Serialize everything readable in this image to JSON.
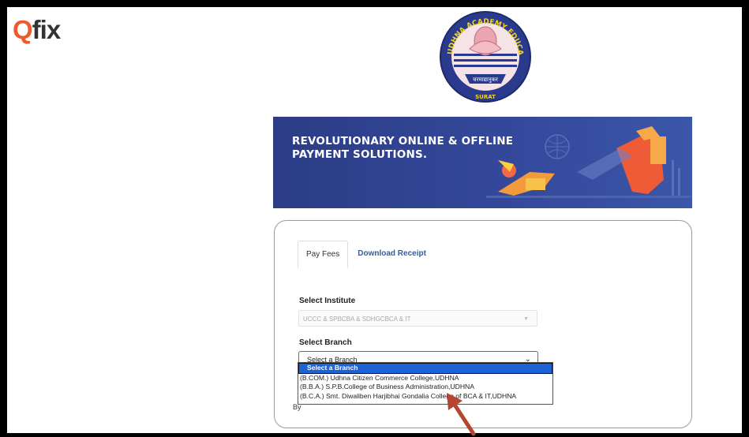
{
  "brand": {
    "logo_text": "fix",
    "logo_q": "Q"
  },
  "emblem": {
    "top_text": "UDHNA ACADEMY EDUCATION TRUST",
    "bottom_text": "SURAT",
    "motto": "चरमाद्यानुकर"
  },
  "banner": {
    "title": "REVOLUTIONARY ONLINE & OFFLINE PAYMENT SOLUTIONS."
  },
  "tabs": [
    {
      "label": "Pay Fees"
    },
    {
      "label": "Download Receipt"
    }
  ],
  "form": {
    "institute_label": "Select Institute",
    "institute_value": "UCCC & SPBCBA & SDHGCBCA & IT",
    "branch_label": "Select Branch",
    "branch_value": "Select a Branch",
    "options": [
      "Select a Branch",
      "(B.COM.) Udhna Citizen Commerce College,UDHNA",
      "(B.B.A.) S.P.B.College of Business Administration,UDHNA",
      "(B.C.A.) Smt. Diwaliben Harjibhai Gondalia College of BCA & IT,UDHNA"
    ],
    "by_text": "By"
  },
  "colors": {
    "accent": "#f05a28",
    "banner": "#2c3d86",
    "selected": "#1e63d6",
    "pointer": "#b5452f"
  }
}
